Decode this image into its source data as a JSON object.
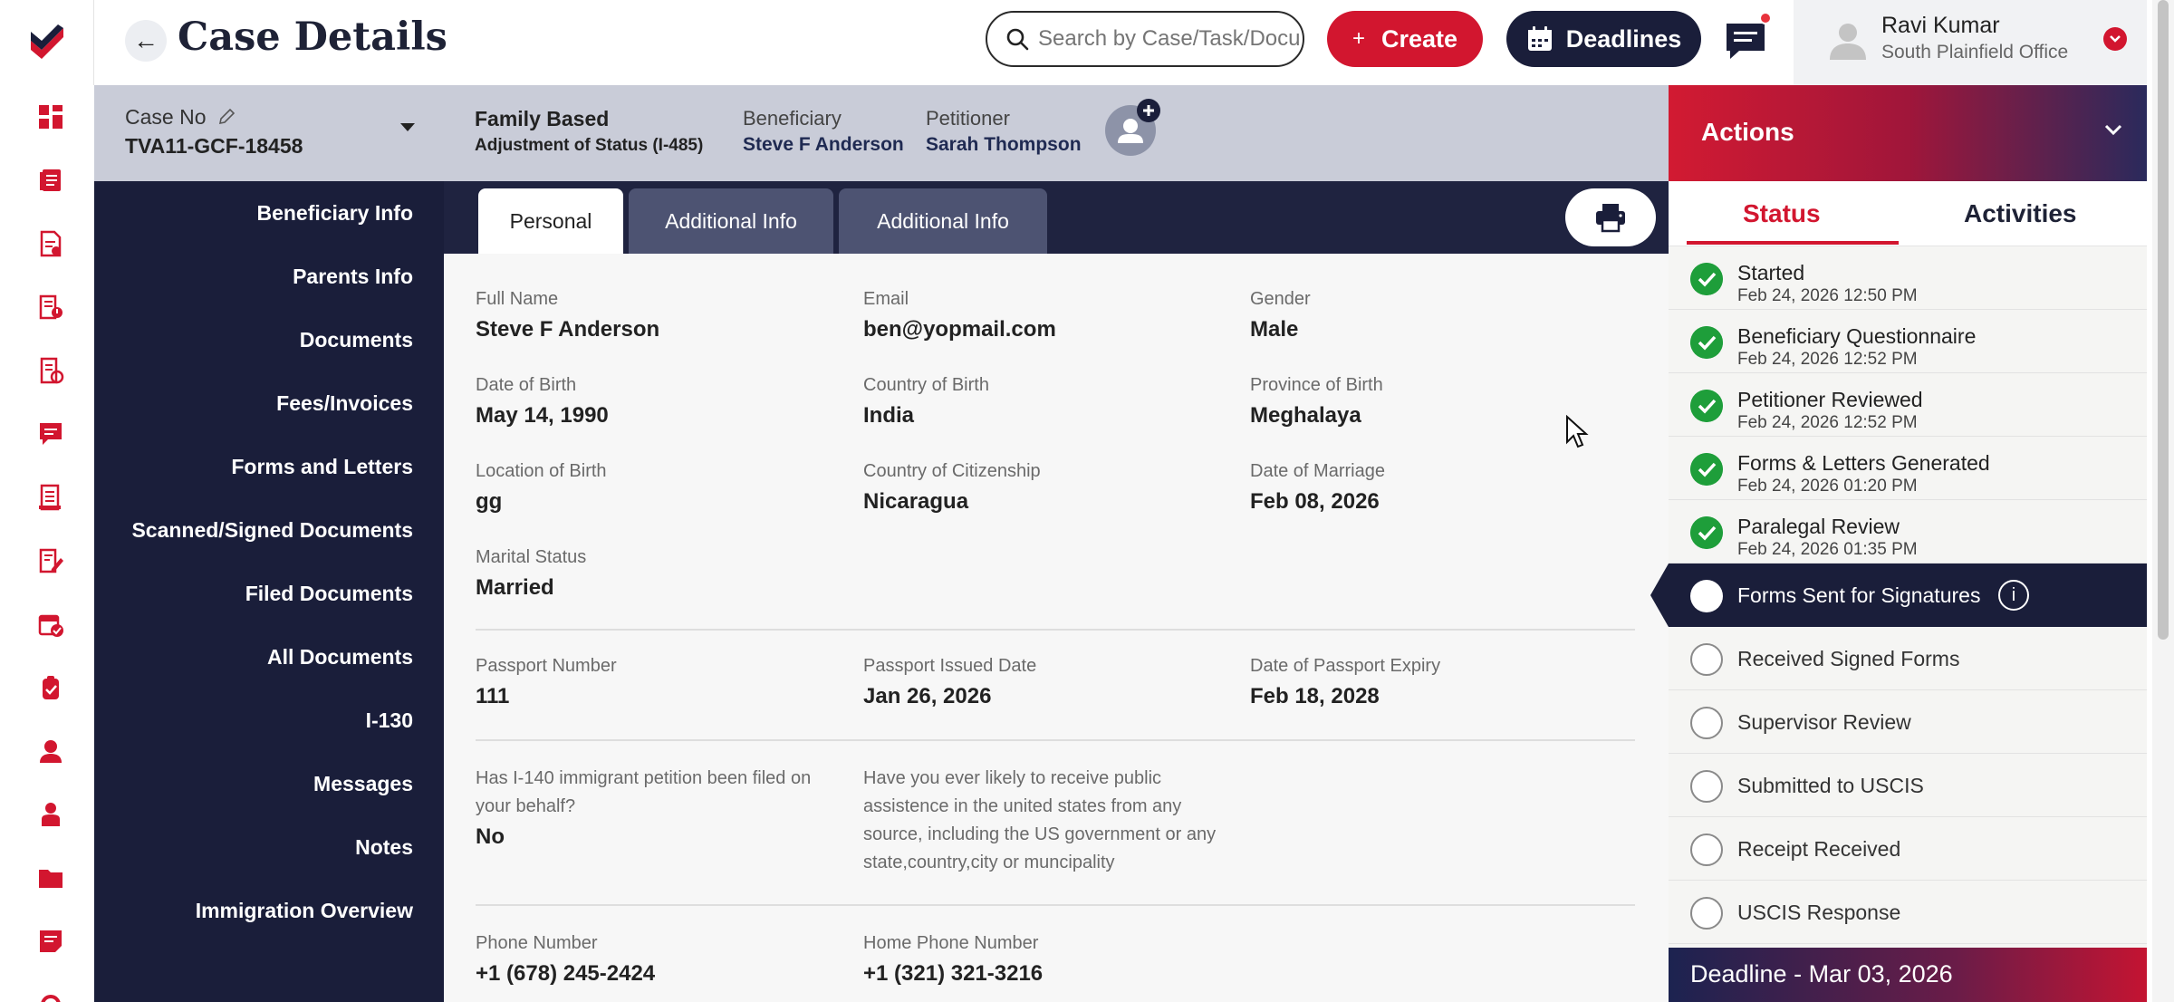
{
  "header": {
    "page_title": "Case Details",
    "search_placeholder": "Search by Case/Task/Docu",
    "create_label": "Create",
    "deadlines_label": "Deadlines",
    "user_name": "Ravi Kumar",
    "user_office": "South Plainfield Office"
  },
  "rail_icons": [
    "dashboard-icon",
    "cases-icon",
    "documents-icon",
    "forms-icon",
    "tasks-icon",
    "chat-icon",
    "ledger-icon",
    "edit-doc-icon",
    "calendar-check-icon",
    "clipboard-icon",
    "contact-icon",
    "user-icon",
    "folder-icon",
    "note-icon",
    "settings-icon"
  ],
  "case": {
    "case_no_label": "Case No",
    "case_no": "TVA11-GCF-18458",
    "type_title": "Family Based",
    "type_sub": "Adjustment of Status (I-485)",
    "beneficiary_label": "Beneficiary",
    "beneficiary": "Steve F Anderson",
    "petitioner_label": "Petitioner",
    "petitioner": "Sarah Thompson"
  },
  "sections": [
    "Beneficiary Info",
    "Parents Info",
    "Documents",
    "Fees/Invoices",
    "Forms and Letters",
    "Scanned/Signed Documents",
    "Filed Documents",
    "All Documents",
    "I-130",
    "Messages",
    "Notes",
    "Immigration Overview"
  ],
  "tabs": [
    "Personal",
    "Additional Info",
    "Additional Info"
  ],
  "fields": {
    "full_name": {
      "label": "Full Name",
      "value": "Steve F Anderson"
    },
    "email": {
      "label": "Email",
      "value": "ben@yopmail.com"
    },
    "gender": {
      "label": "Gender",
      "value": "Male"
    },
    "dob": {
      "label": "Date of Birth",
      "value": "May 14, 1990"
    },
    "country_birth": {
      "label": "Country of Birth",
      "value": "India"
    },
    "province_birth": {
      "label": "Province of Birth",
      "value": "Meghalaya"
    },
    "location_birth": {
      "label": "Location of Birth",
      "value": "gg"
    },
    "citizenship": {
      "label": "Country of Citizenship",
      "value": "Nicaragua"
    },
    "marriage_date": {
      "label": "Date of Marriage",
      "value": "Feb 08, 2026"
    },
    "marital_status": {
      "label": "Marital Status",
      "value": "Married"
    },
    "passport_no": {
      "label": "Passport Number",
      "value": "111"
    },
    "passport_issued": {
      "label": "Passport Issued Date",
      "value": "Jan 26, 2026"
    },
    "passport_expiry": {
      "label": "Date of Passport Expiry",
      "value": "Feb 18, 2028"
    },
    "i140": {
      "label": "Has I-140 immigrant petition been filed on your behalf?",
      "value": "No"
    },
    "public_assist": {
      "label": "Have you ever likely to receive public assistence in the united states from any source, including the US government or any state,country,city or muncipality",
      "value": ""
    },
    "phone": {
      "label": "Phone Number",
      "value": "+1 (678) 245-2424"
    },
    "home_phone": {
      "label": "Home Phone Number",
      "value": "+1 (321) 321-3216"
    }
  },
  "actions": {
    "title": "Actions",
    "tab_status": "Status",
    "tab_activities": "Activities",
    "statuses": [
      {
        "name": "Started",
        "date": "Feb 24, 2026 12:50 PM",
        "state": "done"
      },
      {
        "name": "Beneficiary Questionnaire",
        "date": "Feb 24, 2026 12:52 PM",
        "state": "done"
      },
      {
        "name": "Petitioner Reviewed",
        "date": "Feb 24, 2026 12:52 PM",
        "state": "done"
      },
      {
        "name": "Forms & Letters Generated",
        "date": "Feb 24, 2026 01:20 PM",
        "state": "done"
      },
      {
        "name": "Paralegal Review",
        "date": "Feb 24, 2026 01:35 PM",
        "state": "done"
      },
      {
        "name": "Forms Sent for Signatures",
        "date": "",
        "state": "current"
      },
      {
        "name": "Received Signed Forms",
        "date": "",
        "state": "pending"
      },
      {
        "name": "Supervisor Review",
        "date": "",
        "state": "pending"
      },
      {
        "name": "Submitted to USCIS",
        "date": "",
        "state": "pending"
      },
      {
        "name": "Receipt Received",
        "date": "",
        "state": "pending"
      },
      {
        "name": "USCIS Response",
        "date": "",
        "state": "pending"
      }
    ],
    "info_glyph": "i",
    "deadline": "Deadline - Mar 03, 2026"
  },
  "colors": {
    "brand_red": "#d2162f",
    "navy": "#1a1e3a",
    "done_green": "#1e9e3a"
  }
}
